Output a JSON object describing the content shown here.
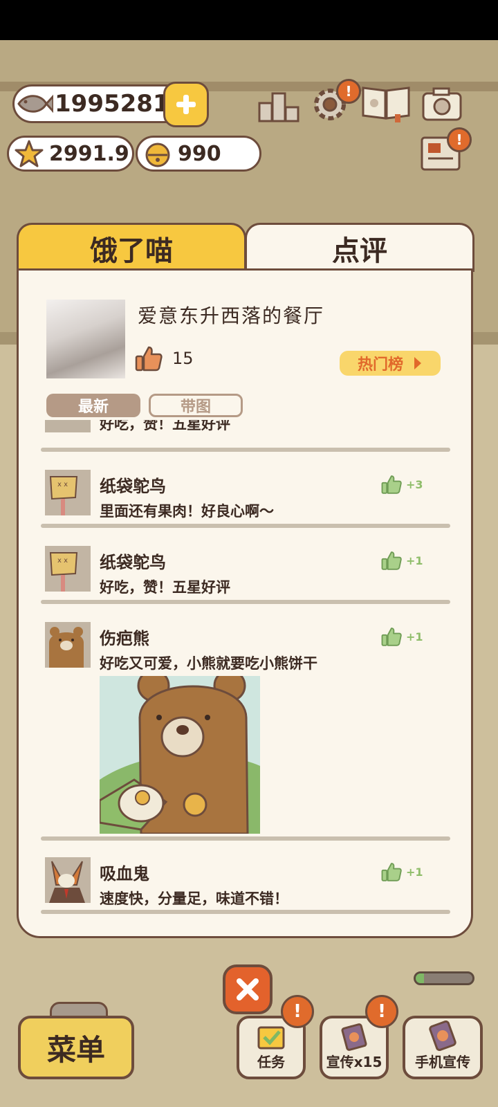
{
  "currency": {
    "fish": "1995281",
    "star": "2991.9",
    "bell": "990"
  },
  "modal": {
    "tabs": [
      "饿了喵",
      "点评"
    ],
    "active_tab": "点评",
    "restaurant": {
      "name": "爱意东升西落的餐厅",
      "likes": "15",
      "hot_label": "热门榜"
    },
    "filters": [
      "最新",
      "带图"
    ],
    "active_filter": "最新",
    "reviews": [
      {
        "text": "好吃，赞！五星好评",
        "partial": true
      },
      {
        "name": "纸袋鸵鸟",
        "text": "里面还有果肉！好良心啊～",
        "likes": "+3"
      },
      {
        "name": "纸袋鸵鸟",
        "text": "好吃，赞！五星好评",
        "likes": "+1"
      },
      {
        "name": "伤疤熊",
        "text": "好吃又可爱，小熊就要吃小熊饼干",
        "likes": "+1",
        "has_image": true
      },
      {
        "name": "吸血鬼",
        "text": "速度快，分量足，味道不错！",
        "likes": "+1"
      }
    ]
  },
  "bottom": {
    "menu_label": "菜单",
    "tasks_label": "任务",
    "promo_label": "宣传x15",
    "phone_promo_label": "手机宣传",
    "badge": "!",
    "progress": 0.15
  },
  "colors": {
    "accent": "#f7c840",
    "outline": "#6d4c3c",
    "like_green": "#8fbd6a",
    "hot_orange": "#e1692b"
  }
}
